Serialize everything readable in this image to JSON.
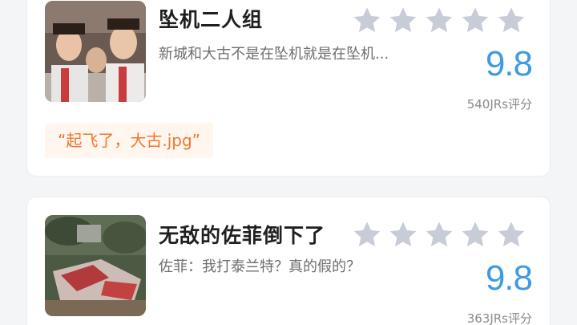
{
  "colors": {
    "score": "#3f9be0",
    "star_inactive": "#c8ccd6",
    "quote_text": "#f0762e",
    "quote_bg": "#fff6ef"
  },
  "cards": [
    {
      "title": "坠机二人组",
      "description": "新城和大古不是在坠机就是在坠机...",
      "rating_stars_filled": 0,
      "rating_stars_total": 5,
      "score": "9.8",
      "count": "540JRs评分",
      "quote": "“起飞了，大古.jpg”"
    },
    {
      "title": "无敌的佐菲倒下了",
      "description": "佐菲：我打泰兰特？真的假的？",
      "rating_stars_filled": 0,
      "rating_stars_total": 5,
      "score": "9.8",
      "count": "363JRs评分"
    }
  ]
}
